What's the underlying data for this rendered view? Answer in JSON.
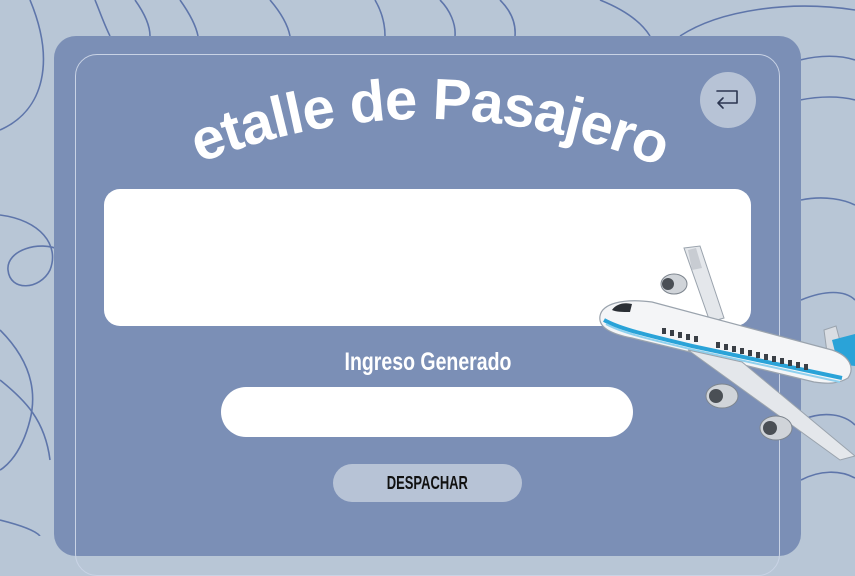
{
  "page": {
    "title": "Detalle de Pasajeros",
    "ingreso_label": "Ingreso Generado",
    "ingreso_value": "",
    "dispatch_label": "DESPACHAR",
    "back_icon": "return-arrow-icon",
    "plane_image": "airplane-illustration"
  },
  "colors": {
    "background": "#b8c6d6",
    "card": "#7b8fb6",
    "button": "#b7c3d6",
    "field": "#ffffff"
  }
}
